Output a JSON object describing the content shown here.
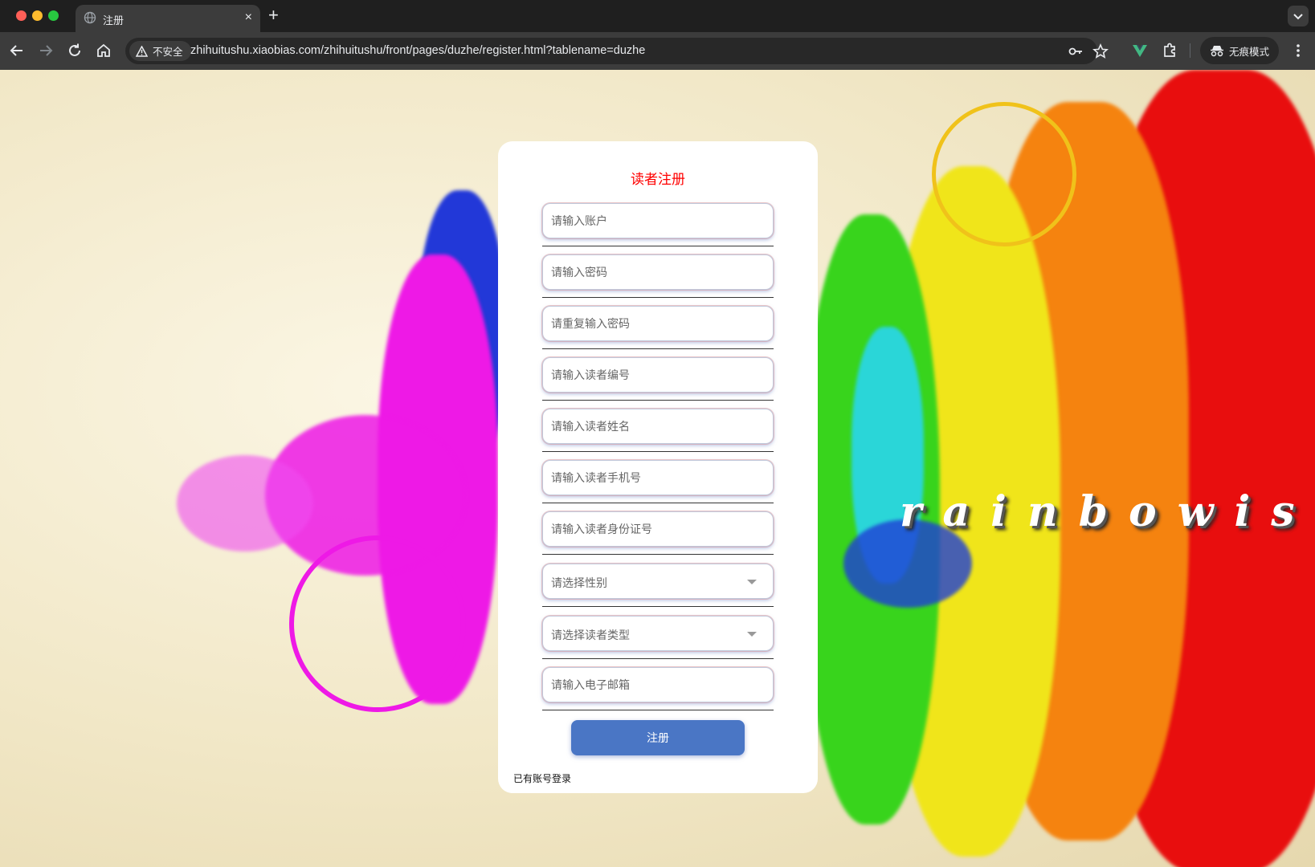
{
  "browser": {
    "tab_title": "注册",
    "new_tab": "+",
    "tab_close": "×",
    "security_label": "不安全",
    "url": "zhihuitushu.xiaobias.com/zhihuitushu/front/pages/duzhe/register.html?tablename=duzhe",
    "incognito_label": "无痕模式"
  },
  "page": {
    "background_text": "rainbowism"
  },
  "form": {
    "title": "读者注册",
    "fields": [
      {
        "placeholder": "请输入账户"
      },
      {
        "placeholder": "请输入密码"
      },
      {
        "placeholder": "请重复输入密码"
      },
      {
        "placeholder": "请输入读者编号"
      },
      {
        "placeholder": "请输入读者姓名"
      },
      {
        "placeholder": "请输入读者手机号"
      },
      {
        "placeholder": "请输入读者身份证号"
      },
      {
        "placeholder": "请选择性别"
      },
      {
        "placeholder": "请选择读者类型"
      },
      {
        "placeholder": "请输入电子邮箱"
      }
    ],
    "submit_label": "注册",
    "login_link": "已有账号登录"
  },
  "colors": {
    "title_red": "#ff0000",
    "submit_blue": "#4a76c5"
  }
}
